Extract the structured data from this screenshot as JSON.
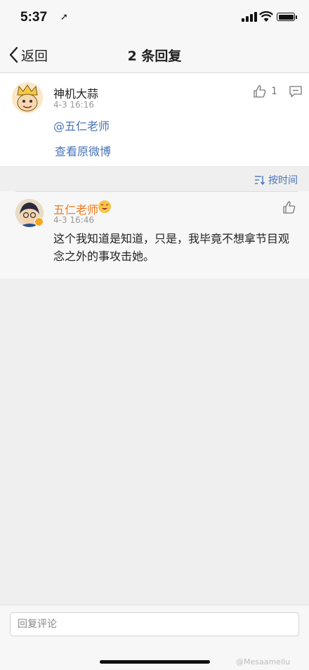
{
  "status_bar": {
    "time": "5:37",
    "location_icon": "location-arrow-icon"
  },
  "nav": {
    "back_label": "返回",
    "title": "2 条回复"
  },
  "root_comment": {
    "author": "神机大蒜",
    "date": "4-3 16:16",
    "text": "@五仁老师",
    "view_original": "查看原微博",
    "like_count": "1"
  },
  "sort": {
    "label": "按时间"
  },
  "reply": {
    "author": "五仁老师",
    "date": "4-3 16:46",
    "text": "这个我知道是知道，只是，我毕竟不想拿节目观念之外的事攻击她。"
  },
  "bottom": {
    "input_placeholder": "回复评论",
    "watermark": "@Mesaamellu"
  },
  "colors": {
    "link": "#4a74b8",
    "author_orange": "#f07a1d",
    "background": "#efefef"
  }
}
